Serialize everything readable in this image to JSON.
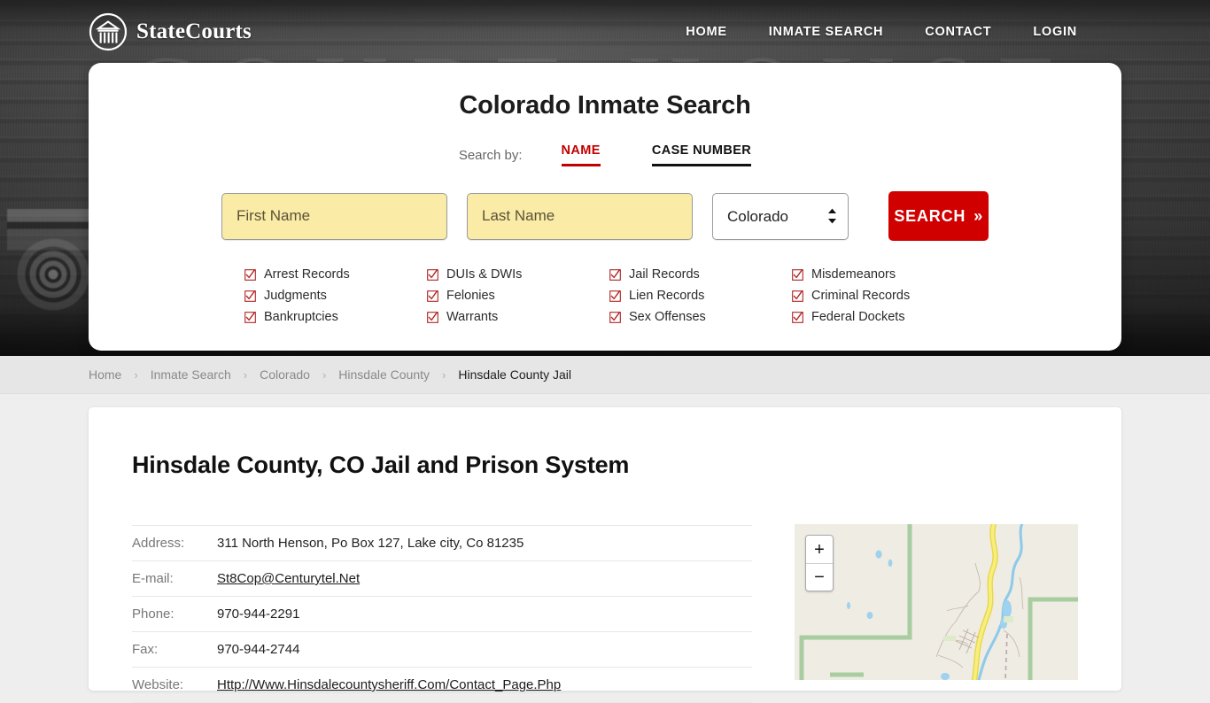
{
  "header": {
    "brand_name": "StateCourts",
    "logo_icon": "courthouse-circle-icon",
    "hero_engraved_text": "COURT HOUSE",
    "nav": [
      {
        "label": "HOME"
      },
      {
        "label": "INMATE SEARCH"
      },
      {
        "label": "CONTACT"
      },
      {
        "label": "LOGIN"
      }
    ]
  },
  "search": {
    "title": "Colorado Inmate Search",
    "search_by_label": "Search by:",
    "tabs": [
      {
        "label": "NAME",
        "active": true
      },
      {
        "label": "CASE NUMBER",
        "active": false
      }
    ],
    "first_name_placeholder": "First Name",
    "first_name_value": "",
    "last_name_placeholder": "Last Name",
    "last_name_value": "",
    "state_selected": "Colorado",
    "state_options": [
      "Colorado"
    ],
    "submit_label": "SEARCH",
    "submit_chevron": "»",
    "accent_color": "#d10000",
    "active_tab_color": "#c20000",
    "input_autofill_color": "#faeba6",
    "record_types": [
      "Arrest Records",
      "DUIs & DWIs",
      "Jail Records",
      "Misdemeanors",
      "Judgments",
      "Felonies",
      "Lien Records",
      "Criminal Records",
      "Bankruptcies",
      "Warrants",
      "Sex Offenses",
      "Federal Dockets"
    ]
  },
  "breadcrumb": {
    "separator": "›",
    "items": [
      {
        "label": "Home",
        "current": false
      },
      {
        "label": "Inmate Search",
        "current": false
      },
      {
        "label": "Colorado",
        "current": false
      },
      {
        "label": "Hinsdale County",
        "current": false
      },
      {
        "label": "Hinsdale County Jail",
        "current": true
      }
    ]
  },
  "main": {
    "page_title": "Hinsdale County, CO Jail and Prison System",
    "info_rows": [
      {
        "key": "Address:",
        "value": "311 North Henson, Po Box 127, Lake city, Co 81235",
        "link": false
      },
      {
        "key": "E-mail:",
        "value": "St8Cop@Centurytel.Net",
        "link": true
      },
      {
        "key": "Phone:",
        "value": "970-944-2291",
        "link": false
      },
      {
        "key": "Fax:",
        "value": "970-944-2744",
        "link": false
      },
      {
        "key": "Website:",
        "value": "Http://Www.Hinsdalecountysheriff.Com/Contact_Page.Php",
        "link": true
      }
    ]
  },
  "map": {
    "zoom_in_label": "+",
    "zoom_out_label": "−",
    "background_color": "#efece3",
    "boundary_color": "#a8cda0",
    "road_color": "#f5e96a",
    "water_color": "#8ecaea"
  }
}
